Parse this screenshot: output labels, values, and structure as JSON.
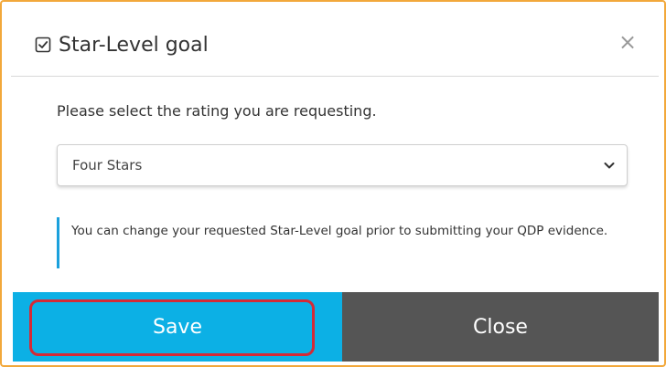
{
  "dialog": {
    "title": "Star-Level goal",
    "title_icon": "checkbox-checked-icon",
    "close_icon": "close-icon",
    "close_glyph": "×"
  },
  "form": {
    "prompt": "Please select the rating you are requesting.",
    "rating_select": {
      "selected": "Four Stars",
      "icon": "chevron-down-icon"
    },
    "note": "You can change your requested Star-Level goal prior to submitting your QDP evidence."
  },
  "footer": {
    "save_label": "Save",
    "close_label": "Close"
  },
  "colors": {
    "frame_border": "#f2a83b",
    "note_accent": "#1aa0dc",
    "save_bg": "#0cb0e5",
    "close_bg": "#555555",
    "highlight": "#d42a36"
  }
}
